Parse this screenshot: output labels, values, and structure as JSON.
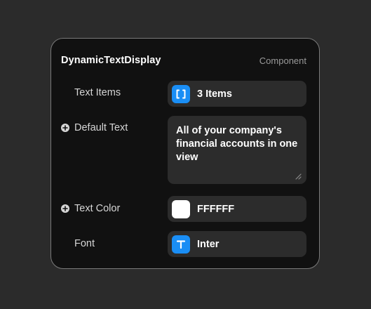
{
  "panel": {
    "title": "DynamicTextDisplay",
    "kind": "Component"
  },
  "rows": {
    "text_items": {
      "label": "Text Items",
      "value": "3 Items",
      "icon": "array-brackets-icon"
    },
    "default_text": {
      "label": "Default Text",
      "value": "All of your company's financial accounts in one view",
      "icon": "plus-circle-icon"
    },
    "text_color": {
      "label": "Text Color",
      "value": "FFFFFF",
      "swatch_color": "#FFFFFF",
      "icon": "plus-circle-icon"
    },
    "font": {
      "label": "Font",
      "value": "Inter",
      "icon": "text-t-icon"
    }
  },
  "colors": {
    "accent": "#1a8ef5",
    "panel_bg": "#111111",
    "field_bg": "#2c2c2c",
    "page_bg": "#2b2b2b"
  }
}
